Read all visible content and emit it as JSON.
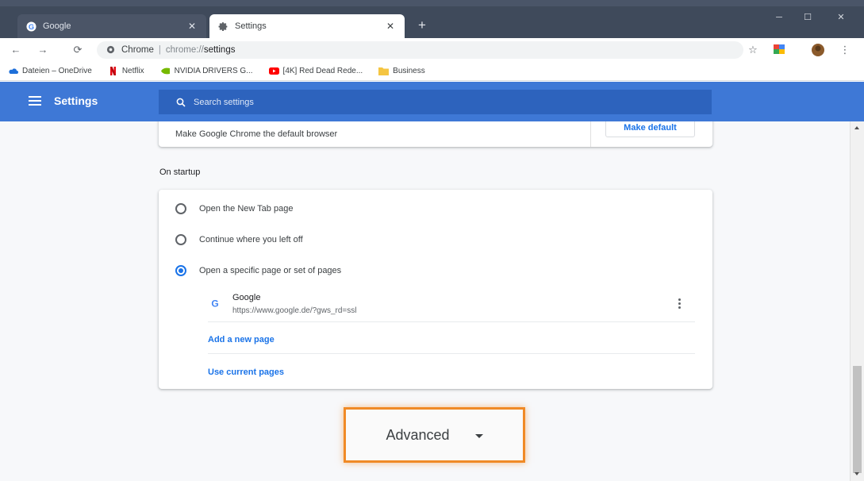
{
  "tabs": [
    {
      "title": "Google",
      "active": false
    },
    {
      "title": "Settings",
      "active": true
    }
  ],
  "omnibox": {
    "scheme_label": "Chrome",
    "url_scheme": "chrome://",
    "url_path": "settings"
  },
  "bookmarks": [
    {
      "label": "Dateien – OneDrive",
      "icon": "onedrive-cloud-icon",
      "color": "#1e6fd9"
    },
    {
      "label": "Netflix",
      "icon": "netflix-icon",
      "color": "#e50914"
    },
    {
      "label": "NVIDIA DRIVERS G...",
      "icon": "nvidia-icon",
      "color": "#76b900"
    },
    {
      "label": "[4K] Red Dead Rede...",
      "icon": "youtube-icon",
      "color": "#ff0000"
    },
    {
      "label": "Business",
      "icon": "folder-icon",
      "color": "#f5c542"
    }
  ],
  "header": {
    "title": "Settings"
  },
  "search": {
    "placeholder": "Search settings"
  },
  "default_browser": {
    "text": "Make Google Chrome the default browser",
    "button": "Make default"
  },
  "startup": {
    "title": "On startup",
    "options": [
      {
        "label": "Open the New Tab page",
        "checked": false
      },
      {
        "label": "Continue where you left off",
        "checked": false
      },
      {
        "label": "Open a specific page or set of pages",
        "checked": true
      }
    ],
    "pages": [
      {
        "name": "Google",
        "url": "https://www.google.de/?gws_rd=ssl"
      }
    ],
    "add_page": "Add a new page",
    "use_current": "Use current pages"
  },
  "advanced": {
    "label": "Advanced"
  },
  "colors": {
    "accent": "#1a73e8",
    "header": "#3e78d6",
    "highlight": "#f08a26"
  }
}
